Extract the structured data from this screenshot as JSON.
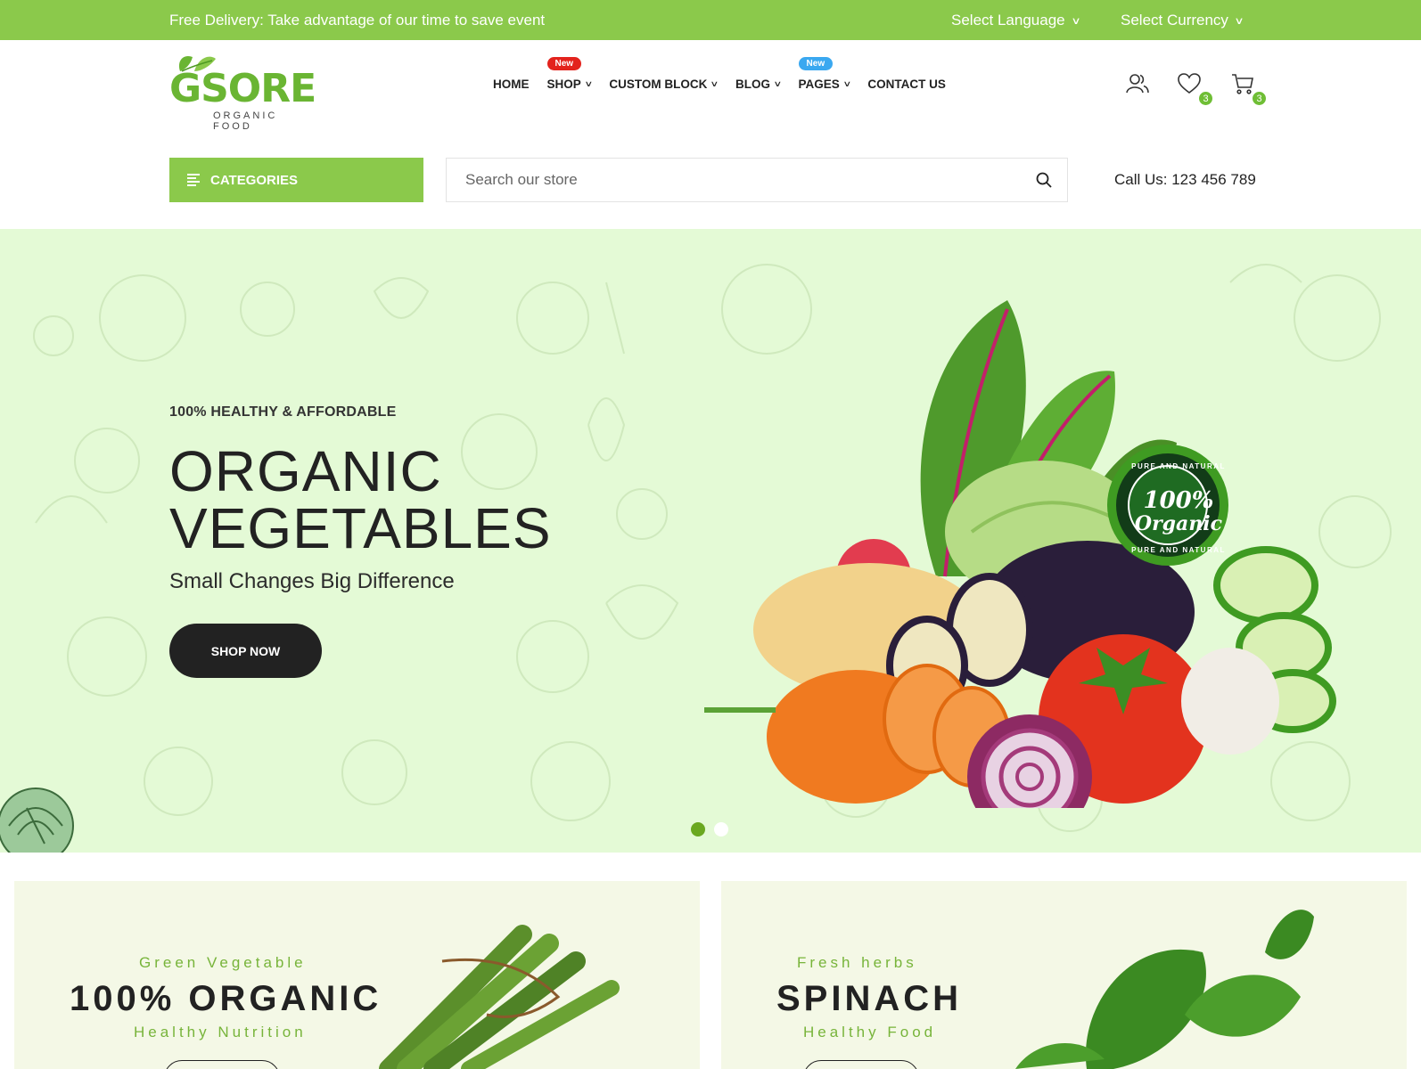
{
  "topbar": {
    "promo": "Free Delivery: Take advantage of our time to save event",
    "language_label": "Select Language",
    "currency_label": "Select Currency",
    "background": "#8bc94b"
  },
  "logo": {
    "word": "GSORE",
    "tagline": "ORGANIC FOOD"
  },
  "nav": {
    "home": "HOME",
    "shop": "SHOP",
    "shop_badge": "New",
    "custom_block": "CUSTOM BLOCK",
    "blog": "BLOG",
    "pages": "PAGES",
    "pages_badge": "New",
    "contact": "CONTACT US"
  },
  "header_icons": {
    "account": "user-icon",
    "wishlist": "heart-icon",
    "wishlist_count": "3",
    "cart": "cart-icon",
    "cart_count": "3"
  },
  "categories_label": "CATEGORIES",
  "search": {
    "placeholder": "Search our store"
  },
  "call": "Call Us: 123 456 789",
  "hero": {
    "kicker": "100% HEALTHY & AFFORDABLE",
    "title_line1": "ORGANIC",
    "title_line2": "VEGETABLES",
    "subtitle": "Small Changes Big Difference",
    "button": "SHOP NOW",
    "seal_top": "PURE AND NATURAL",
    "seal_line1": "100%",
    "seal_line2": "Organic",
    "seal_bottom": "PURE AND NATURAL",
    "background": "#e4fad6",
    "active_slide": 1,
    "slide_count": 2
  },
  "banners": [
    {
      "kicker": "Green Vegetable",
      "title": "100% ORGANIC",
      "sub": "Healthy Nutrition"
    },
    {
      "kicker": "Fresh herbs",
      "title": "SPINACH",
      "sub": "Healthy Food"
    }
  ],
  "colors": {
    "accent": "#8bc94b",
    "dark": "#222222",
    "badge_red": "#e3231d",
    "badge_blue": "#3aa8f0"
  }
}
